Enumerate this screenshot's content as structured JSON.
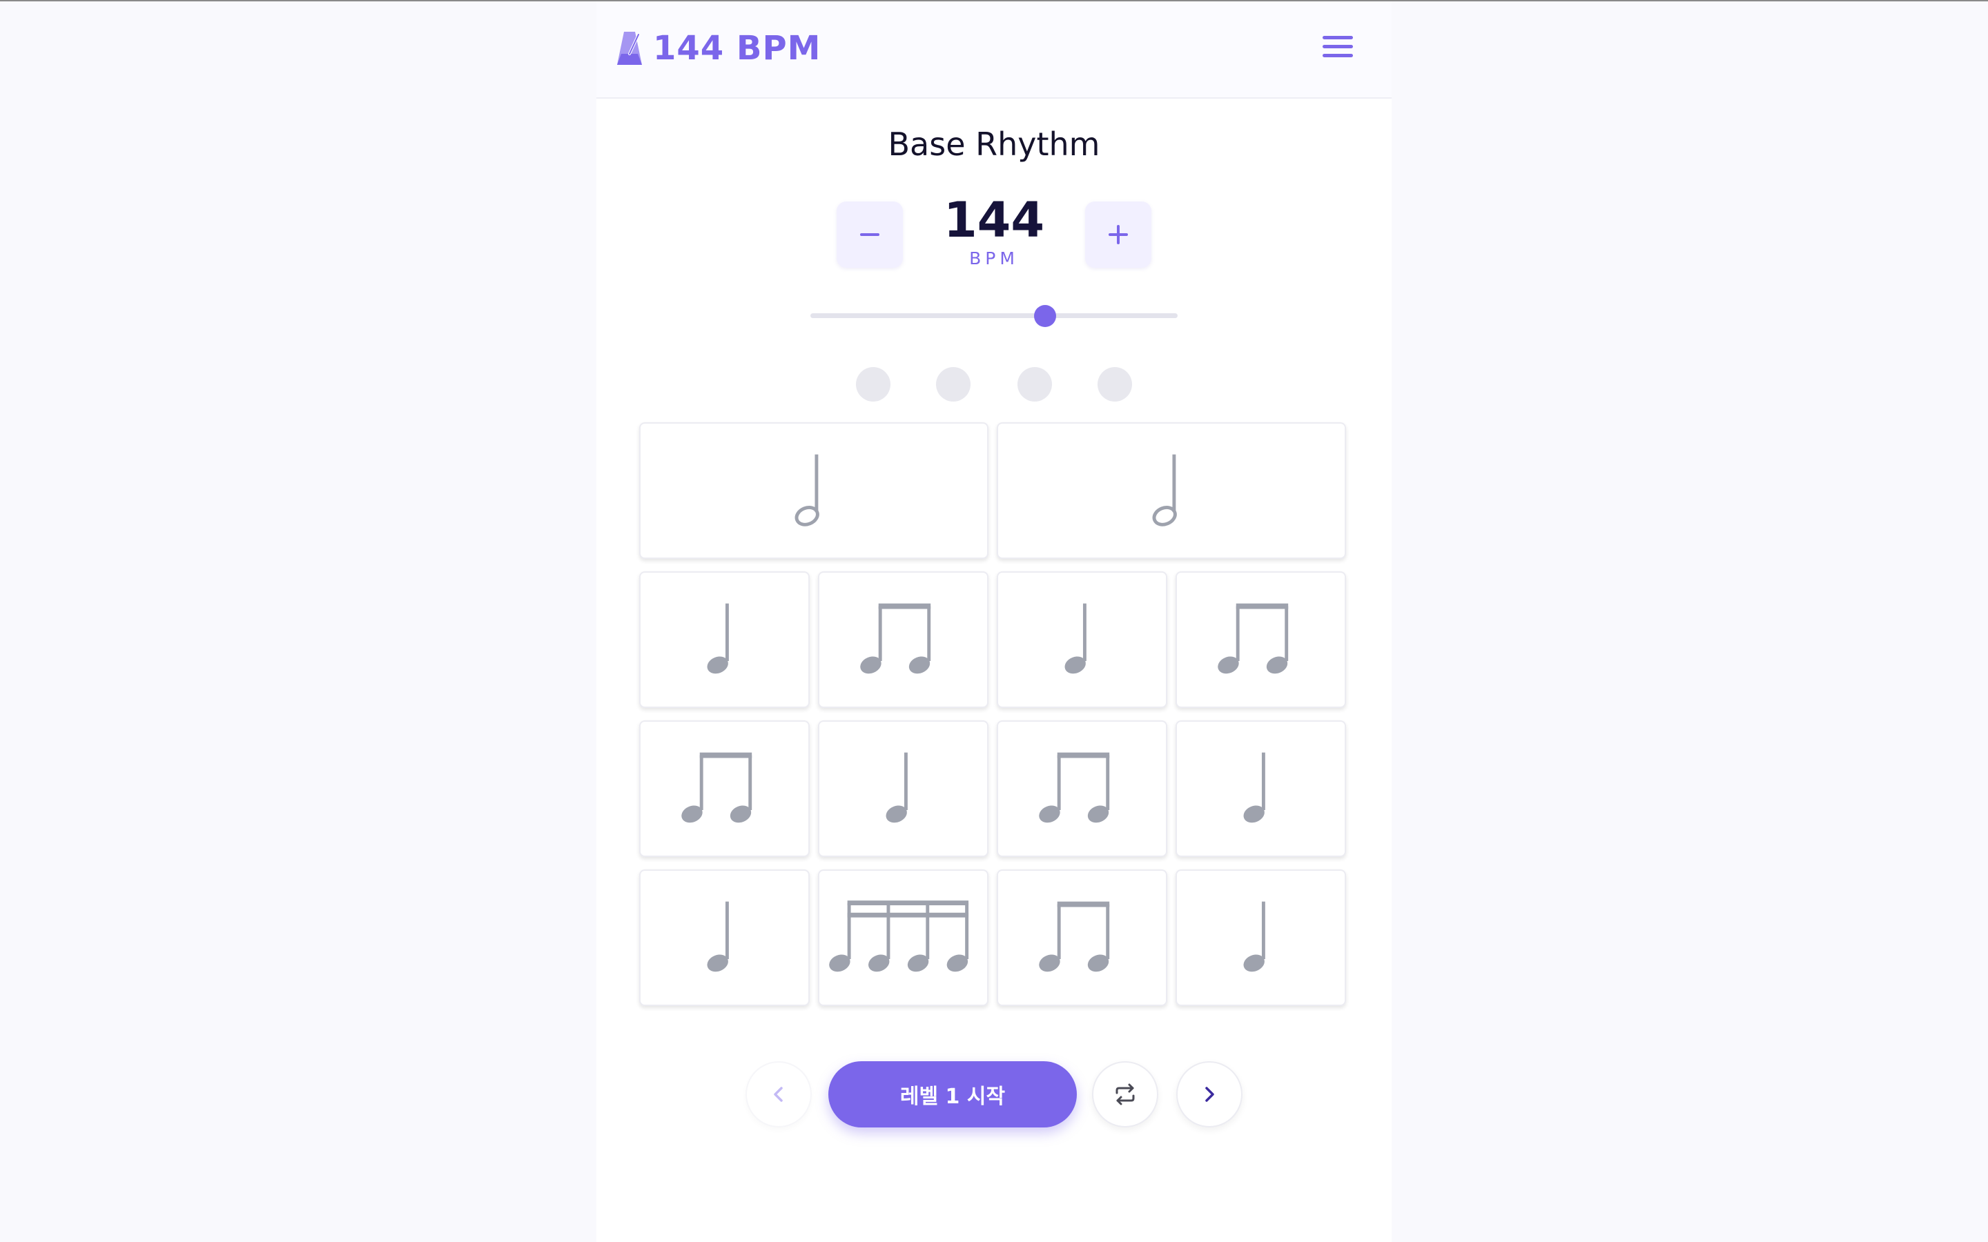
{
  "header": {
    "logo_icon": "metronome-icon",
    "title": "144 BPM",
    "menu_icon": "hamburger-menu-icon"
  },
  "main": {
    "title": "Base Rhythm",
    "tempo": {
      "value": "144",
      "unit": "BPM",
      "decrease_icon": "minus-icon",
      "increase_icon": "plus-icon",
      "slider_fraction": 0.64
    },
    "beats": {
      "count": 4,
      "active": 0
    },
    "rhythm_grid": [
      [
        "half",
        "half"
      ],
      [
        "quarter",
        "eighth-pair",
        "quarter",
        "eighth-pair"
      ],
      [
        "eighth-pair",
        "quarter",
        "eighth-pair",
        "quarter"
      ],
      [
        "quarter",
        "sixteenth-quad",
        "eighth-pair",
        "quarter"
      ]
    ]
  },
  "controls": {
    "prev_icon": "chevron-left-icon",
    "start_label": "레벨 1 시작",
    "repeat_icon": "repeat-icon",
    "next_icon": "chevron-right-icon"
  },
  "colors": {
    "accent": "#7b66ea",
    "note": "#9ea2ad",
    "text_dark": "#14122b"
  }
}
